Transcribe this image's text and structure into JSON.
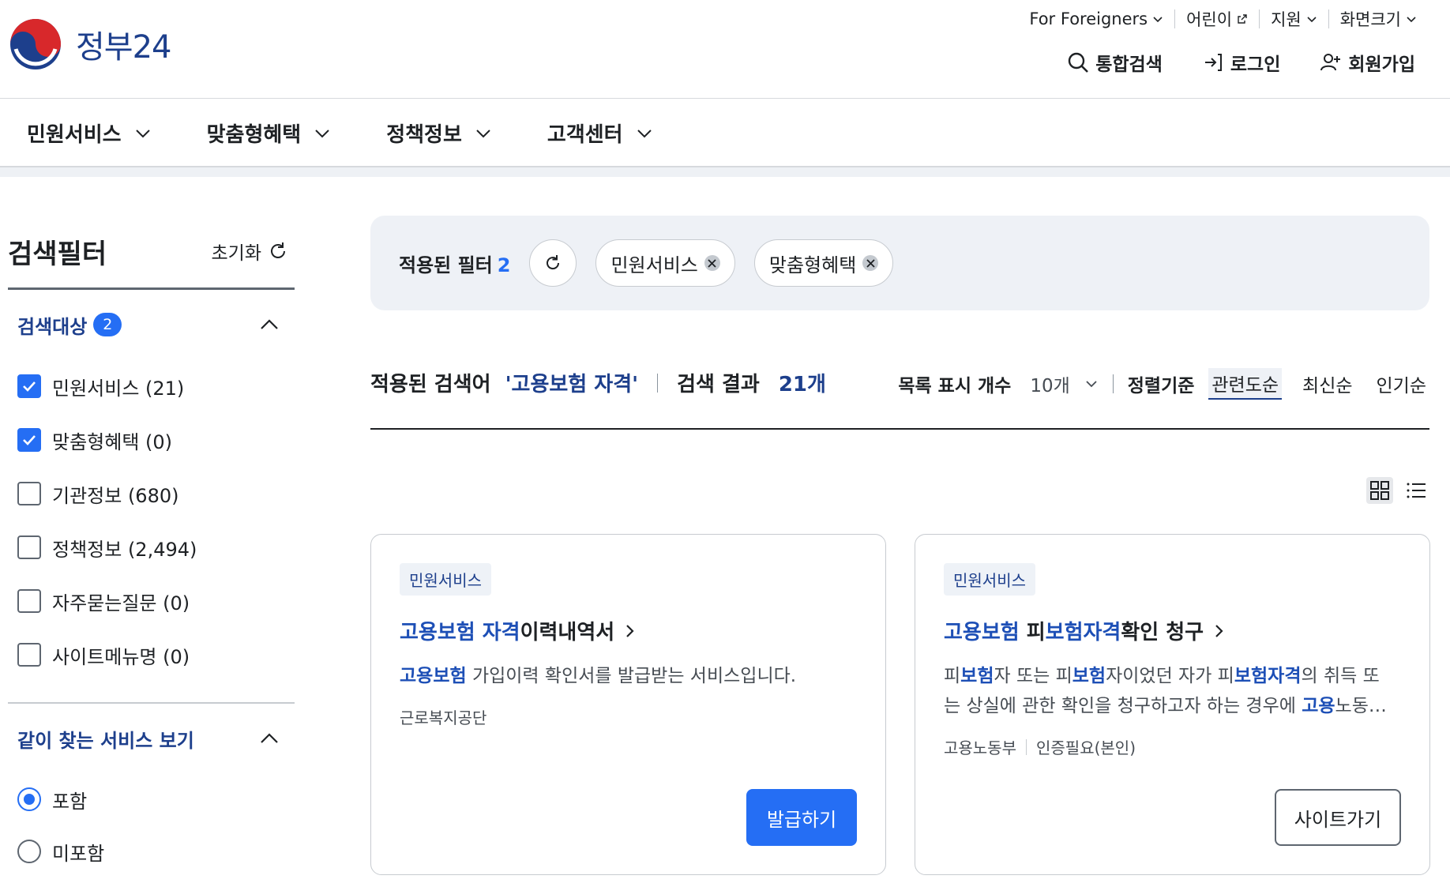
{
  "header": {
    "logo_text": "정부24",
    "utility": [
      {
        "label": "For Foreigners"
      },
      {
        "label": "어린이"
      },
      {
        "label": "지원"
      },
      {
        "label": "화면크기"
      }
    ],
    "actions": {
      "search": "통합검색",
      "login": "로그인",
      "signup": "회원가입"
    }
  },
  "gnb": {
    "items": [
      {
        "label": "민원서비스"
      },
      {
        "label": "맞춤형혜택"
      },
      {
        "label": "정책정보"
      },
      {
        "label": "고객센터"
      }
    ]
  },
  "sidebar": {
    "title": "검색필터",
    "reset_label": "초기화",
    "target_group": {
      "title": "검색대상",
      "badge": "2",
      "options": [
        {
          "label": "민원서비스 (21)",
          "checked": true
        },
        {
          "label": "맞춤형혜택 (0)",
          "checked": true
        },
        {
          "label": "기관정보 (680)",
          "checked": false
        },
        {
          "label": "정책정보 (2,494)",
          "checked": false
        },
        {
          "label": "자주묻는질문 (0)",
          "checked": false
        },
        {
          "label": "사이트메뉴명 (0)",
          "checked": false
        }
      ]
    },
    "related_group": {
      "title": "같이 찾는 서비스 보기",
      "options": [
        {
          "label": "포함",
          "selected": true
        },
        {
          "label": "미포함",
          "selected": false
        }
      ]
    }
  },
  "applied_filters": {
    "label": "적용된 필터",
    "count": "2",
    "chips": [
      {
        "label": "민원서비스"
      },
      {
        "label": "맞춤형혜택"
      }
    ]
  },
  "results": {
    "query_label": "적용된 검색어",
    "query": "'고용보험 자격'",
    "result_label": "검색 결과",
    "result_count": "21개",
    "per_page_label": "목록 표시 개수",
    "per_page_value": "10개",
    "sort_label": "정렬기준",
    "sort_options": [
      {
        "label": "관련도순",
        "active": true
      },
      {
        "label": "최신순",
        "active": false
      },
      {
        "label": "인기순",
        "active": false
      }
    ]
  },
  "cards": [
    {
      "tag": "민원서비스",
      "title_hl1": "고용보험",
      "title_sp1": " ",
      "title_hl2": "자격",
      "title_rest": "이력내역서",
      "desc_hl": "고용보험",
      "desc_rest": " 가입이력 확인서를 발급받는 서비스입니다.",
      "meta": [
        "근로복지공단"
      ],
      "button": "발급하기"
    },
    {
      "tag": "민원서비스",
      "title_hl1": "고용보험",
      "title_t1": " 피",
      "title_hl2": "보험자격",
      "title_rest": "확인 청구",
      "desc_line1": {
        "a": "피",
        "b": "보험",
        "c": "자 또는 피",
        "d": "보험",
        "e": "자이었던 자가 피",
        "f": "보험자격",
        "g": "의 취득 또"
      },
      "desc_line2": {
        "a": "는 상실에 관한 확인을 청구하고자 하는 경우에 ",
        "b": "고용",
        "c": "노동…"
      },
      "meta": [
        "고용노동부",
        "인증필요(본인)"
      ],
      "button": "사이트가기"
    }
  ],
  "colors": {
    "primary": "#256ef4",
    "navy": "#1d3f8c",
    "brand_red": "#d8282b"
  }
}
